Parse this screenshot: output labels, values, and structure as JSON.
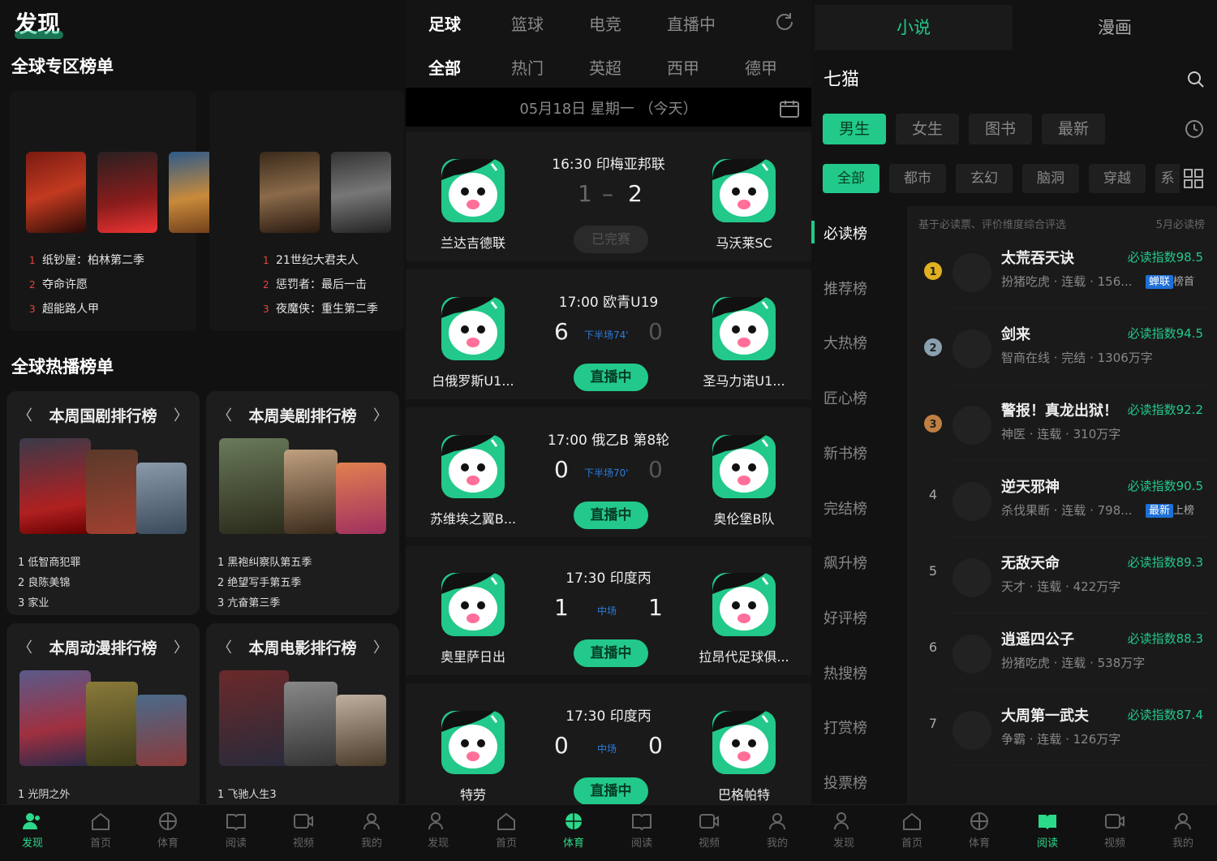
{
  "discover": {
    "logo": "发现",
    "section1": "全球专区榜单",
    "zone_left": [
      "纸钞屋：柏林第二季",
      "夺命许愿",
      "超能路人甲"
    ],
    "zone_right": [
      "21世纪大君夫人",
      "惩罚者：最后一击",
      "夜魔侠：重生第二季"
    ],
    "section2": "全球热播榜单",
    "cards": [
      {
        "title": "本周国剧排行榜",
        "items": [
          "1 低智商犯罪",
          "2 良陈美锦",
          "3 家业"
        ]
      },
      {
        "title": "本周美剧排行榜",
        "items": [
          "1 黑袍纠察队第五季",
          "2 绝望写手第五季",
          "3 亢奋第三季"
        ]
      },
      {
        "title": "本周动漫排行榜",
        "items": [
          "1 光阴之外"
        ]
      },
      {
        "title": "本周电影排行榜",
        "items": [
          "1 飞驰人生3"
        ]
      }
    ]
  },
  "sports": {
    "tabs": [
      "足球",
      "篮球",
      "电竞",
      "直播中"
    ],
    "leagues": [
      "全部",
      "热门",
      "英超",
      "西甲",
      "德甲"
    ],
    "date": "05月18日 星期一 （今天）",
    "matches": [
      {
        "title": "16:30 印梅亚邦联",
        "home": "兰达吉德联",
        "away": "马沃莱SC",
        "hs": "1",
        "as": "2",
        "half": "",
        "status": "已完赛"
      },
      {
        "title": "17:00 欧青U19",
        "home": "白俄罗斯U1...",
        "away": "圣马力诺U1...",
        "hs": "6",
        "as": "0",
        "half": "下半场74'",
        "status": "直播中"
      },
      {
        "title": "17:00 俄乙B 第8轮",
        "home": "苏维埃之翼B...",
        "away": "奥伦堡B队",
        "hs": "0",
        "as": "0",
        "half": "下半场70'",
        "status": "直播中"
      },
      {
        "title": "17:30 印度丙",
        "home": "奥里萨日出",
        "away": "拉昂代足球俱...",
        "hs": "1",
        "as": "1",
        "half": "中场",
        "status": "直播中"
      },
      {
        "title": "17:30 印度丙",
        "home": "特劳",
        "away": "巴格帕特",
        "hs": "0",
        "as": "0",
        "half": "中场",
        "status": "直播中"
      }
    ]
  },
  "novel": {
    "top_tabs": [
      "小说",
      "漫画"
    ],
    "brand": "七猫",
    "filters": [
      "男生",
      "女生",
      "图书",
      "最新"
    ],
    "genres": [
      "全部",
      "都市",
      "玄幻",
      "脑洞",
      "穿越",
      "系"
    ],
    "side": [
      "必读榜",
      "推荐榜",
      "大热榜",
      "匠心榜",
      "新书榜",
      "完结榜",
      "飙升榜",
      "好评榜",
      "热搜榜",
      "打赏榜",
      "投票榜"
    ],
    "hint": "基于必读票、评价维度综合评选",
    "month": "5月必读榜",
    "books": [
      {
        "rank": "1",
        "title": "太荒吞天诀",
        "meta": "扮猪吃虎 · 连载 · 156...",
        "index": "必读指数98.5",
        "tag": "蝉联",
        "tagtext": "榜首"
      },
      {
        "rank": "2",
        "title": "剑来",
        "meta": "智商在线 · 完结 · 1306万字",
        "index": "必读指数94.5",
        "tag": "",
        "tagtext": ""
      },
      {
        "rank": "3",
        "title": "警报！真龙出狱！",
        "meta": "神医 · 连载 · 310万字",
        "index": "必读指数92.2",
        "tag": "",
        "tagtext": ""
      },
      {
        "rank": "4",
        "title": "逆天邪神",
        "meta": "杀伐果断 · 连载 · 798...",
        "index": "必读指数90.5",
        "tag": "最新",
        "tagtext": "上榜"
      },
      {
        "rank": "5",
        "title": "无敌天命",
        "meta": "天才 · 连载 · 422万字",
        "index": "必读指数89.3",
        "tag": "",
        "tagtext": ""
      },
      {
        "rank": "6",
        "title": "逍遥四公子",
        "meta": "扮猪吃虎 · 连载 · 538万字",
        "index": "必读指数88.3",
        "tag": "",
        "tagtext": ""
      },
      {
        "rank": "7",
        "title": "大周第一武夫",
        "meta": "争霸 · 连载 · 126万字",
        "index": "必读指数87.4",
        "tag": "",
        "tagtext": ""
      }
    ]
  },
  "nav": [
    "发现",
    "首页",
    "体育",
    "阅读",
    "视频",
    "我的"
  ],
  "colors": {
    "accent": "#22c98a",
    "live_blue": "#2b7de0",
    "rank_red": "#e8453c"
  }
}
